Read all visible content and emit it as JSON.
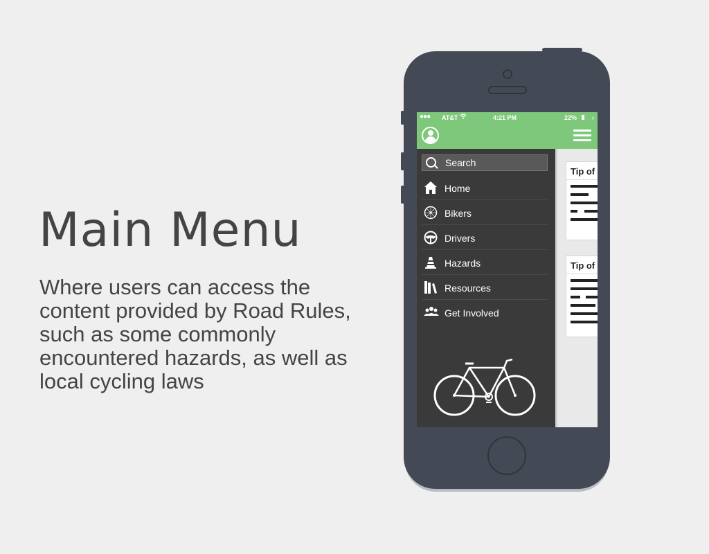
{
  "promo": {
    "title": "Main Menu",
    "description": "Where users can access the content provided by Road Rules, such as some commonly encountered hazards, as well as local cycling laws"
  },
  "status_bar": {
    "carrier": "AT&T",
    "time": "4:21 PM",
    "battery": "22%"
  },
  "search": {
    "placeholder": "Search"
  },
  "menu": {
    "items": [
      {
        "label": "Home",
        "icon": "home-icon"
      },
      {
        "label": "Bikers",
        "icon": "bike-wheel-icon"
      },
      {
        "label": "Drivers",
        "icon": "steering-wheel-icon"
      },
      {
        "label": "Hazards",
        "icon": "traffic-cone-icon"
      },
      {
        "label": "Resources",
        "icon": "books-icon"
      },
      {
        "label": "Get Involved",
        "icon": "people-icon"
      }
    ]
  },
  "cards": [
    {
      "title": "Tip of"
    },
    {
      "title": "Tip of"
    }
  ],
  "colors": {
    "header_green": "#7dc87a",
    "drawer_bg": "#3a3a3a",
    "phone_body": "#444a55",
    "page_bg": "#efefef"
  }
}
